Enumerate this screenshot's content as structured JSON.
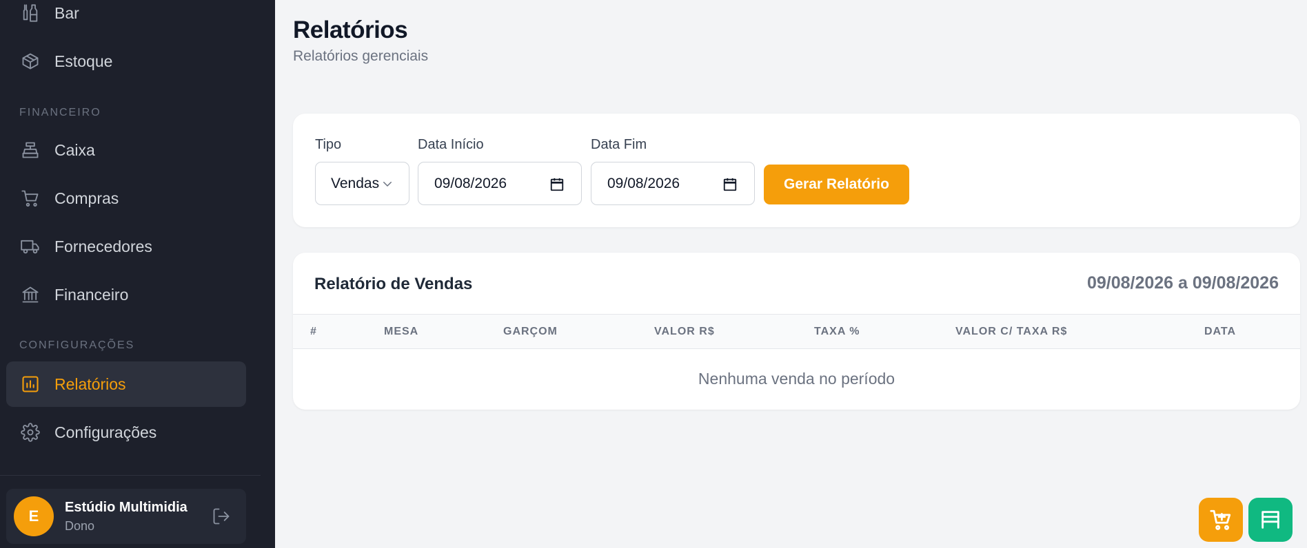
{
  "sidebar": {
    "items": [
      {
        "label": "Bar",
        "icon": "wine-bottle-icon"
      },
      {
        "label": "Estoque",
        "icon": "box-icon"
      },
      {
        "label": "Caixa",
        "icon": "cash-register-icon"
      },
      {
        "label": "Compras",
        "icon": "cart-icon"
      },
      {
        "label": "Fornecedores",
        "icon": "truck-icon"
      },
      {
        "label": "Financeiro",
        "icon": "bank-icon"
      },
      {
        "label": "Relatórios",
        "icon": "bar-chart-icon",
        "active": true
      },
      {
        "label": "Configurações",
        "icon": "gear-icon"
      }
    ],
    "sections": {
      "financeiro": "FINANCEIRO",
      "configuracoes": "CONFIGURAÇÕES"
    },
    "user": {
      "initial": "E",
      "name": "Estúdio Multimidia",
      "role": "Dono"
    }
  },
  "header": {
    "title": "Relatórios",
    "subtitle": "Relatórios gerenciais"
  },
  "filters": {
    "tipo_label": "Tipo",
    "tipo_value": "Vendas",
    "data_inicio_label": "Data Início",
    "data_inicio_value": "09/08/2026",
    "data_fim_label": "Data Fim",
    "data_fim_value": "09/08/2026",
    "generate_label": "Gerar Relatório"
  },
  "report": {
    "title": "Relatório de Vendas",
    "range": "09/08/2026 a 09/08/2026",
    "columns": [
      "#",
      "MESA",
      "GARÇOM",
      "VALOR R$",
      "TAXA %",
      "VALOR C/ TAXA R$",
      "DATA"
    ],
    "rows": [],
    "empty_message": "Nenhuma venda no período"
  },
  "colors": {
    "accent": "#f59e0b",
    "sidebar_bg": "#1d202b",
    "success": "#10b981"
  }
}
